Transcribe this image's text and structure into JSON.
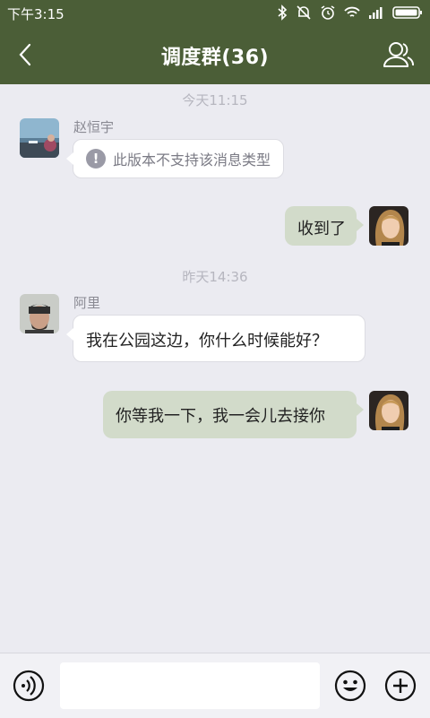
{
  "status_bar": {
    "time": "下午3:15"
  },
  "header": {
    "title": "调度群(36)"
  },
  "messages": [
    {
      "timestamp": "今天11:15"
    },
    {
      "sender": "赵恒宇",
      "text": "此版本不支持该消息类型"
    },
    {
      "text": "收到了"
    },
    {
      "timestamp": "昨天14:36"
    },
    {
      "sender": "阿里",
      "text": "我在公园这边，你什么时候能好？"
    },
    {
      "text": "你等我一下，我一会儿去接你"
    }
  ],
  "input": {
    "placeholder": ""
  },
  "colors": {
    "header": "#4b5e37",
    "background": "#ebebf1",
    "outgoing_bubble": "#d2dbca",
    "incoming_bubble": "#ffffff"
  }
}
